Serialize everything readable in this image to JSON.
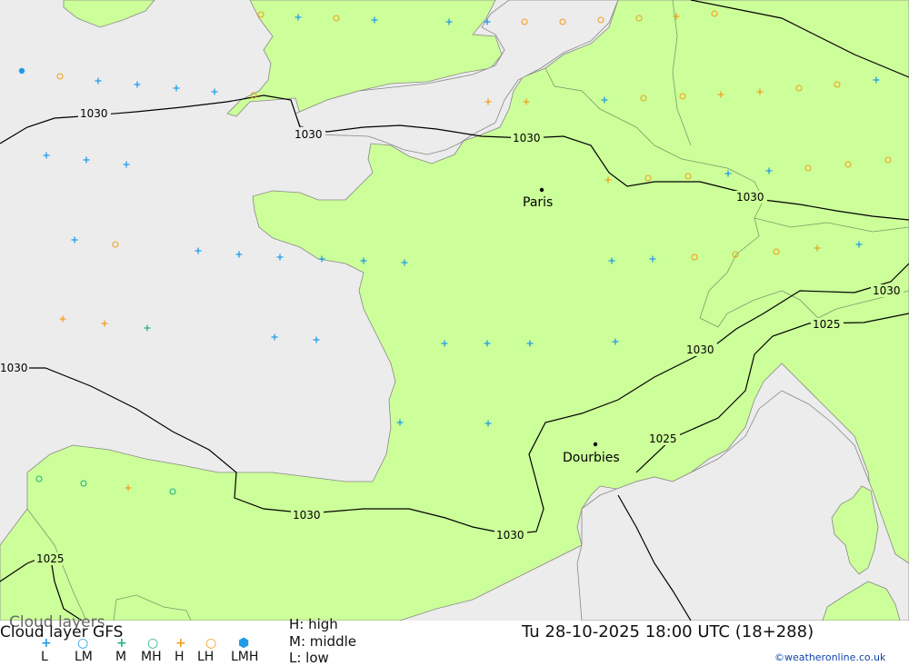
{
  "title": "Cloud layers",
  "model_title": "Cloud layer  GFS",
  "datetime": "Tu 28-10-2025 18:00 UTC (18+288)",
  "credit": "©weatheronline.co.uk",
  "legend": {
    "symbols": [
      {
        "label": "L",
        "glyph": "+",
        "color": "#1f9be8"
      },
      {
        "label": "LM",
        "glyph": "○",
        "color": "#1f9be8"
      },
      {
        "label": "M",
        "glyph": "+",
        "color": "#22b585"
      },
      {
        "label": "MH",
        "glyph": "○",
        "color": "#22b585"
      },
      {
        "label": "H",
        "glyph": "+",
        "color": "#f0a020"
      },
      {
        "label": "LH",
        "glyph": "○",
        "color": "#f0a020"
      },
      {
        "label": "LMH",
        "glyph": "⬢",
        "color": "#1f9be8"
      }
    ],
    "key": [
      "H: high",
      "M: middle",
      "L: low"
    ]
  },
  "places": [
    {
      "name": "Paris"
    },
    {
      "name": "Dourbies"
    }
  ],
  "isobars": [
    {
      "value": "1030"
    },
    {
      "value": "1030"
    },
    {
      "value": "1030"
    },
    {
      "value": "1030"
    },
    {
      "value": "1030"
    },
    {
      "value": "1030"
    },
    {
      "value": "1030"
    },
    {
      "value": "1030"
    },
    {
      "value": "1030"
    },
    {
      "value": "1025"
    },
    {
      "value": "1025"
    },
    {
      "value": "1025"
    }
  ],
  "colors": {
    "land": "#ccff99",
    "sea": "#ececec",
    "isobar": "#000000",
    "low": "#1f9be8",
    "middle": "#22b585",
    "high": "#f0a020"
  }
}
